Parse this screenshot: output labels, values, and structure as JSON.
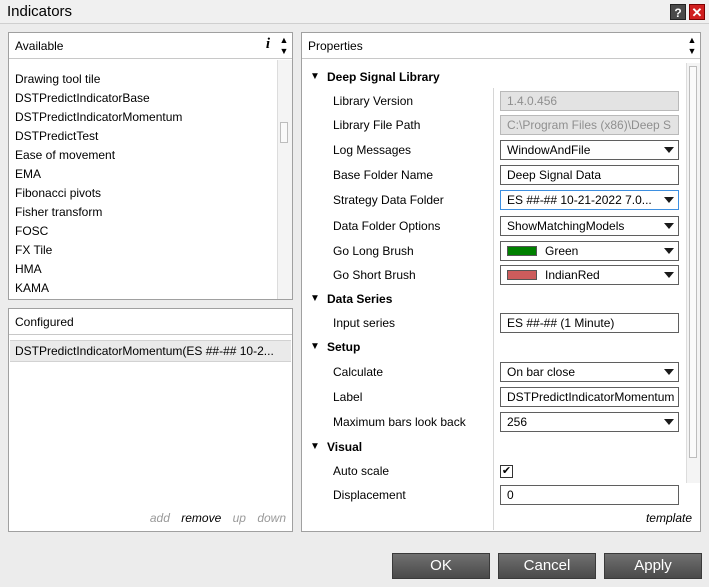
{
  "window": {
    "title": "Indicators",
    "help_glyph": "?",
    "close_glyph": "✕"
  },
  "available": {
    "header": "Available",
    "info_glyph": "i",
    "items": [
      "Drawing tool tile",
      "DSTPredictIndicatorBase",
      "DSTPredictIndicatorMomentum",
      "DSTPredictTest",
      "Ease of movement",
      "EMA",
      "Fibonacci pivots",
      "Fisher transform",
      "FOSC",
      "FX Tile",
      "HMA",
      "KAMA"
    ]
  },
  "configured": {
    "header": "Configured",
    "items": [
      "DSTPredictIndicatorMomentum(ES ##-## 10-2..."
    ],
    "actions": {
      "add": "add",
      "remove": "remove",
      "up": "up",
      "down": "down"
    }
  },
  "properties": {
    "header": "Properties",
    "template_link": "template",
    "categories": {
      "deep_signal": "Deep Signal Library",
      "data_series": "Data Series",
      "setup": "Setup",
      "visual": "Visual"
    },
    "rows": {
      "library_version": {
        "label": "Library Version",
        "value": "1.4.0.456"
      },
      "library_file_path": {
        "label": "Library File Path",
        "value": "C:\\Program Files (x86)\\Deep S"
      },
      "log_messages": {
        "label": "Log Messages",
        "value": "WindowAndFile"
      },
      "base_folder_name": {
        "label": "Base Folder Name",
        "value": "Deep Signal Data"
      },
      "strategy_data_folder": {
        "label": "Strategy Data Folder",
        "value": "ES ##-## 10-21-2022 7.0..."
      },
      "data_folder_options": {
        "label": "Data Folder Options",
        "value": "ShowMatchingModels"
      },
      "go_long_brush": {
        "label": "Go Long Brush",
        "value": "Green",
        "color": "#008000"
      },
      "go_short_brush": {
        "label": "Go Short Brush",
        "value": "IndianRed",
        "color": "#cd5c5c"
      },
      "input_series": {
        "label": "Input series",
        "value": "ES ##-## (1 Minute)"
      },
      "calculate": {
        "label": "Calculate",
        "value": "On bar close"
      },
      "label": {
        "label": "Label",
        "value": "DSTPredictIndicatorMomentum"
      },
      "max_bars_look_back": {
        "label": "Maximum bars look back",
        "value": "256"
      },
      "auto_scale": {
        "label": "Auto scale",
        "checked_glyph": "✔"
      },
      "displacement": {
        "label": "Displacement",
        "value": "0"
      }
    }
  },
  "buttons": {
    "ok": "OK",
    "cancel": "Cancel",
    "apply": "Apply"
  }
}
